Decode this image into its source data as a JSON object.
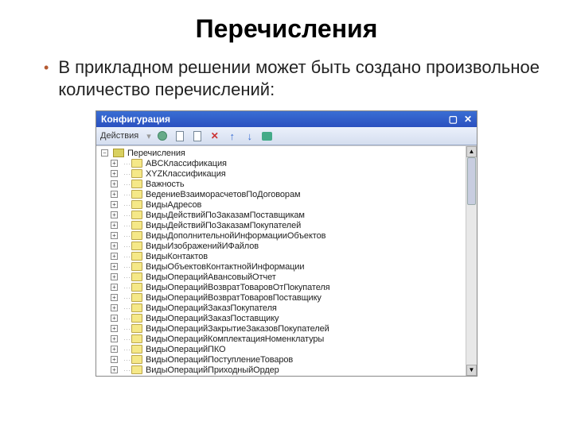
{
  "slide": {
    "title": "Перечисления",
    "bullet": "В прикладном решении может быть создано произвольное количество перечислений:"
  },
  "window": {
    "title": "Конфигурация",
    "toolbar_label": "Действия",
    "tree": {
      "root_label": "Перечисления",
      "items": [
        "ABCКлассификация",
        "XYZКлассификация",
        "Важность",
        "ВедениеВзаиморасчетовПоДоговорам",
        "ВидыАдресов",
        "ВидыДействийПоЗаказамПоставщикам",
        "ВидыДействийПоЗаказамПокупателей",
        "ВидыДополнительнойИнформацииОбъектов",
        "ВидыИзображенийИФайлов",
        "ВидыКонтактов",
        "ВидыОбъектовКонтактнойИнформации",
        "ВидыОперацийАвансовыйОтчет",
        "ВидыОперацийВозвратТоваровОтПокупателя",
        "ВидыОперацийВозвратТоваровПоставщику",
        "ВидыОперацийЗаказПокупателя",
        "ВидыОперацийЗаказПоставщику",
        "ВидыОперацийЗакрытиеЗаказовПокупателей",
        "ВидыОперацийКомплектацияНоменклатуры",
        "ВидыОперацийПКО",
        "ВидыОперацийПоступлениеТоваров",
        "ВидыОперацийПриходныйОрдер"
      ]
    }
  }
}
